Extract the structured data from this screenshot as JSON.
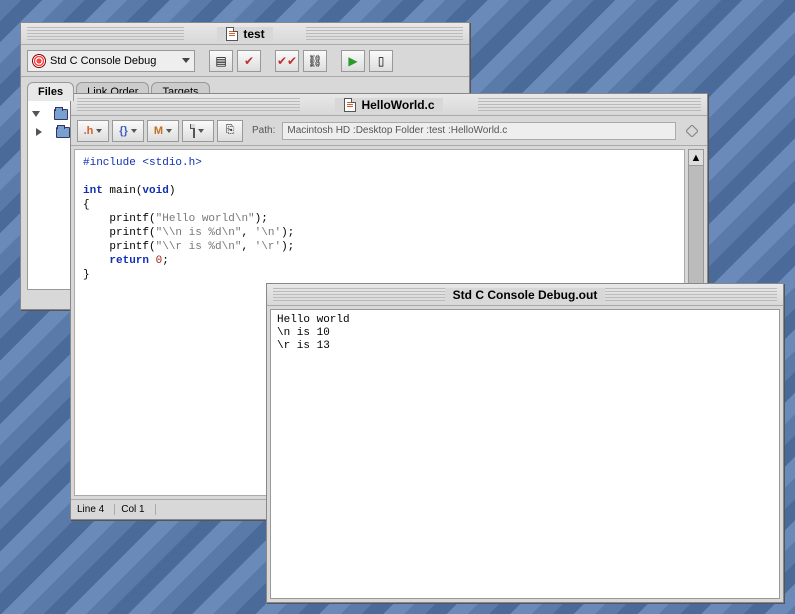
{
  "project": {
    "title": "test",
    "target": "Std C Console Debug",
    "tabs": [
      "Files",
      "Link Order",
      "Targets"
    ],
    "activeTab": 0
  },
  "editor": {
    "title": "HelloWorld.c",
    "pathLabel": "Path:",
    "path": "Macintosh HD :Desktop Folder :test :HelloWorld.c",
    "status": {
      "line": "Line 4",
      "col": "Col 1"
    },
    "code": {
      "l1a": "#include",
      "l1b": "<stdio.h>",
      "l2a": "int",
      "l2b": " main(",
      "l2c": "void",
      "l2d": ")",
      "l3": "{",
      "l4a": "    printf(",
      "l4b": "\"Hello world\\n\"",
      "l4c": ");",
      "l5a": "    printf(",
      "l5b": "\"\\\\n is %d\\n\"",
      "l5c": ", ",
      "l5d": "'\\n'",
      "l5e": ");",
      "l6a": "    printf(",
      "l6b": "\"\\\\r is %d\\n\"",
      "l6c": ", ",
      "l6d": "'\\r'",
      "l6e": ");",
      "l7a": "    ",
      "l7b": "return",
      "l7c": " ",
      "l7d": "0",
      "l7e": ";",
      "l8": "}"
    }
  },
  "console": {
    "title": "Std C Console Debug.out",
    "output": "Hello world\n\\n is 10\n\\r is 13"
  }
}
